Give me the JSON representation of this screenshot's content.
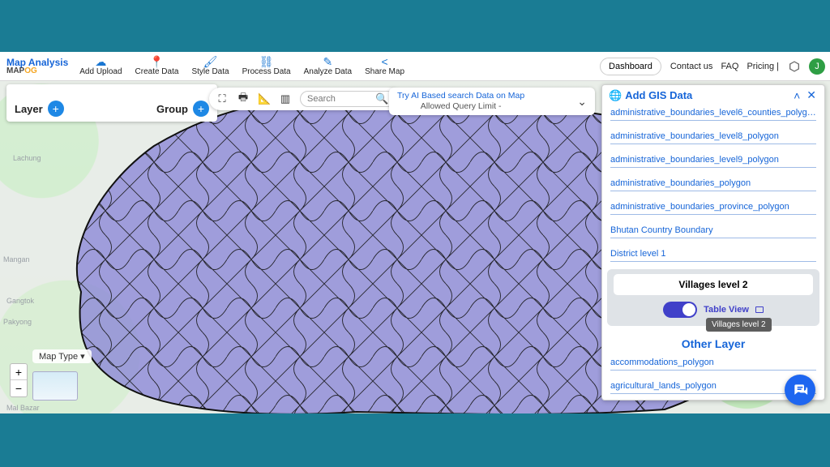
{
  "brand": {
    "line1": "Map Analysis",
    "line2_a": "MAP",
    "line2_b": "OG"
  },
  "menu": {
    "upload": {
      "label": "Add Upload",
      "glyph": "☁"
    },
    "create": {
      "label": "Create Data",
      "glyph": "📍"
    },
    "style": {
      "label": "Style Data",
      "glyph": "🖌"
    },
    "process": {
      "label": "Process Data",
      "glyph": "⛓"
    },
    "analyze": {
      "label": "Analyze Data",
      "glyph": "✎"
    },
    "share": {
      "label": "Share Map",
      "glyph": "<"
    }
  },
  "header": {
    "dashboard": "Dashboard",
    "contact": "Contact us",
    "faq": "FAQ",
    "pricing": "Pricing |",
    "avatar_letter": "J"
  },
  "lg": {
    "layer": "Layer",
    "group": "Group"
  },
  "toolbar": {
    "search_placeholder": "Search"
  },
  "ai": {
    "line1": "Try AI Based search Data on Map",
    "line2": "Allowed Query Limit -"
  },
  "panel": {
    "title": "Add GIS Data",
    "links": [
      "administrative_boundaries_level6_counties_polyg…",
      "administrative_boundaries_level8_polygon",
      "administrative_boundaries_level9_polygon",
      "administrative_boundaries_polygon",
      "administrative_boundaries_province_polygon",
      "Bhutan Country Boundary",
      "District level 1"
    ],
    "selected": "Villages level 2",
    "table_view": "Table View",
    "tooltip": "Villages level 2",
    "other_header": "Other Layer",
    "other_links": [
      "accommodations_polygon",
      "agricultural_lands_polygon"
    ]
  },
  "map": {
    "type_label": "Map Type"
  },
  "bg_labels": {
    "lachung": "Lachung",
    "mangan": "Mangan",
    "gangtok": "Gangtok",
    "pakyong": "Pakyong",
    "malbazar": "Mal Bazar"
  }
}
